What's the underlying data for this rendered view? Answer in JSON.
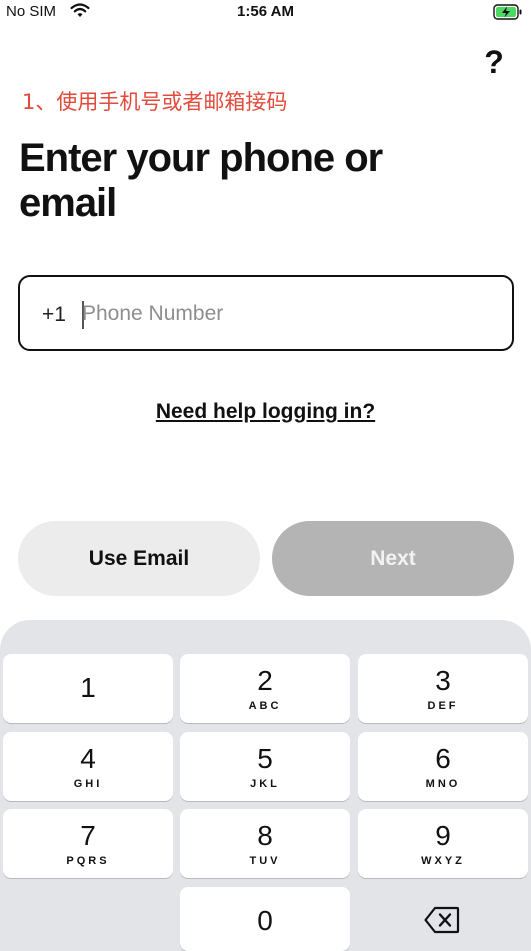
{
  "status_bar": {
    "carrier": "No SIM",
    "time": "1:56 AM"
  },
  "help_button": {
    "label": "?"
  },
  "annotation": "1、使用手机号或者邮箱接码",
  "title": "Enter your phone or email",
  "phone_field": {
    "country_code": "+1",
    "placeholder": "Phone Number",
    "value": ""
  },
  "help_link": "Need help logging in?",
  "buttons": {
    "use_email": "Use Email",
    "next": "Next"
  },
  "keypad": {
    "keys": [
      {
        "num": "1",
        "letters": ""
      },
      {
        "num": "2",
        "letters": "ABC"
      },
      {
        "num": "3",
        "letters": "DEF"
      },
      {
        "num": "4",
        "letters": "GHI"
      },
      {
        "num": "5",
        "letters": "JKL"
      },
      {
        "num": "6",
        "letters": "MNO"
      },
      {
        "num": "7",
        "letters": "PQRS"
      },
      {
        "num": "8",
        "letters": "TUV"
      },
      {
        "num": "9",
        "letters": "WXYZ"
      },
      {
        "num": "0",
        "letters": ""
      }
    ]
  },
  "colors": {
    "annotation": "#e24b3c",
    "next_disabled": "#b4b4b4",
    "keypad_bg": "#e3e4e7",
    "battery_green": "#4cd964"
  }
}
